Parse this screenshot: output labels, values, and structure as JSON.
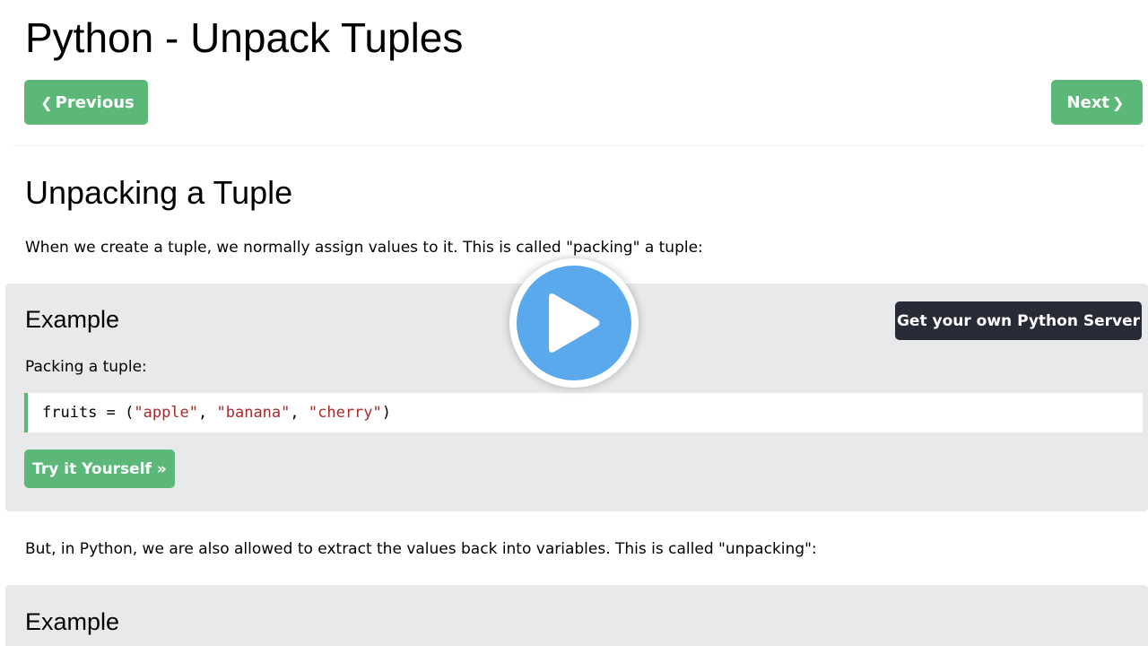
{
  "page": {
    "title": "Python - Unpack Tuples"
  },
  "nav": {
    "previous_label": "Previous",
    "next_label": "Next",
    "previous_icon": "chevron-left-icon",
    "next_icon": "chevron-right-icon"
  },
  "section": {
    "title": "Unpacking a Tuple",
    "intro": "When we create a tuple, we normally assign values to it. This is called \"packing\" a tuple:",
    "after": "But, in Python, we are also allowed to extract the values back into variables. This is called \"unpacking\":"
  },
  "examples": [
    {
      "heading": "Example",
      "server_button": "Get your own Python Server",
      "description": "Packing a tuple:",
      "code": {
        "prefix": "fruits = (",
        "str1": "\"apple\"",
        "sep1": ", ",
        "str2": "\"banana\"",
        "sep2": ", ",
        "str3": "\"cherry\"",
        "suffix": ")"
      },
      "try_button": "Try it Yourself »"
    },
    {
      "heading": "Example"
    }
  ],
  "overlay": {
    "icon": "play-icon"
  },
  "colors": {
    "accent_green": "#5cb878",
    "dark_button": "#282a35",
    "example_bg": "#e7e9eb",
    "play_blue": "#59a9ec",
    "string_color": "#a52a2a"
  }
}
